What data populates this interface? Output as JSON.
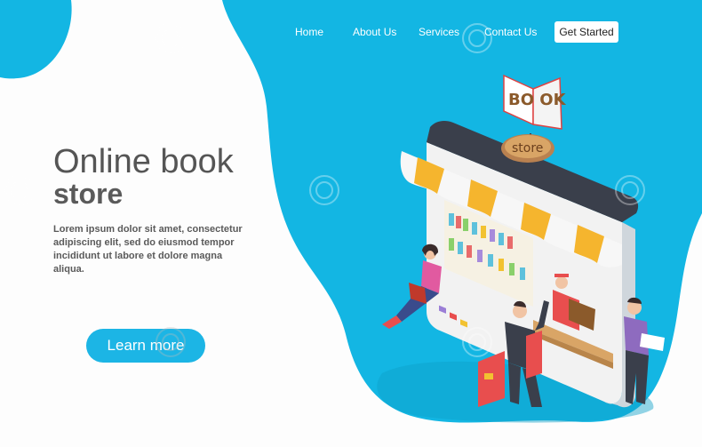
{
  "nav": {
    "items": [
      "Home",
      "About Us",
      "Services",
      "Contact Us"
    ],
    "cta_label": "Get Started"
  },
  "hero": {
    "title_line1": "Online book",
    "title_line2": "store",
    "body": "Lorem ipsum dolor sit amet, consectetur adipiscing elit, sed do eiusmod tempor incididunt ut labore et dolore magna aliqua.",
    "button_label": "Learn more"
  },
  "illustration": {
    "sign_text": "BO OK",
    "plaque_text": "store"
  },
  "colors": {
    "accent": "#1cb5e5",
    "blob": "#13b6e3",
    "text": "#555555"
  }
}
